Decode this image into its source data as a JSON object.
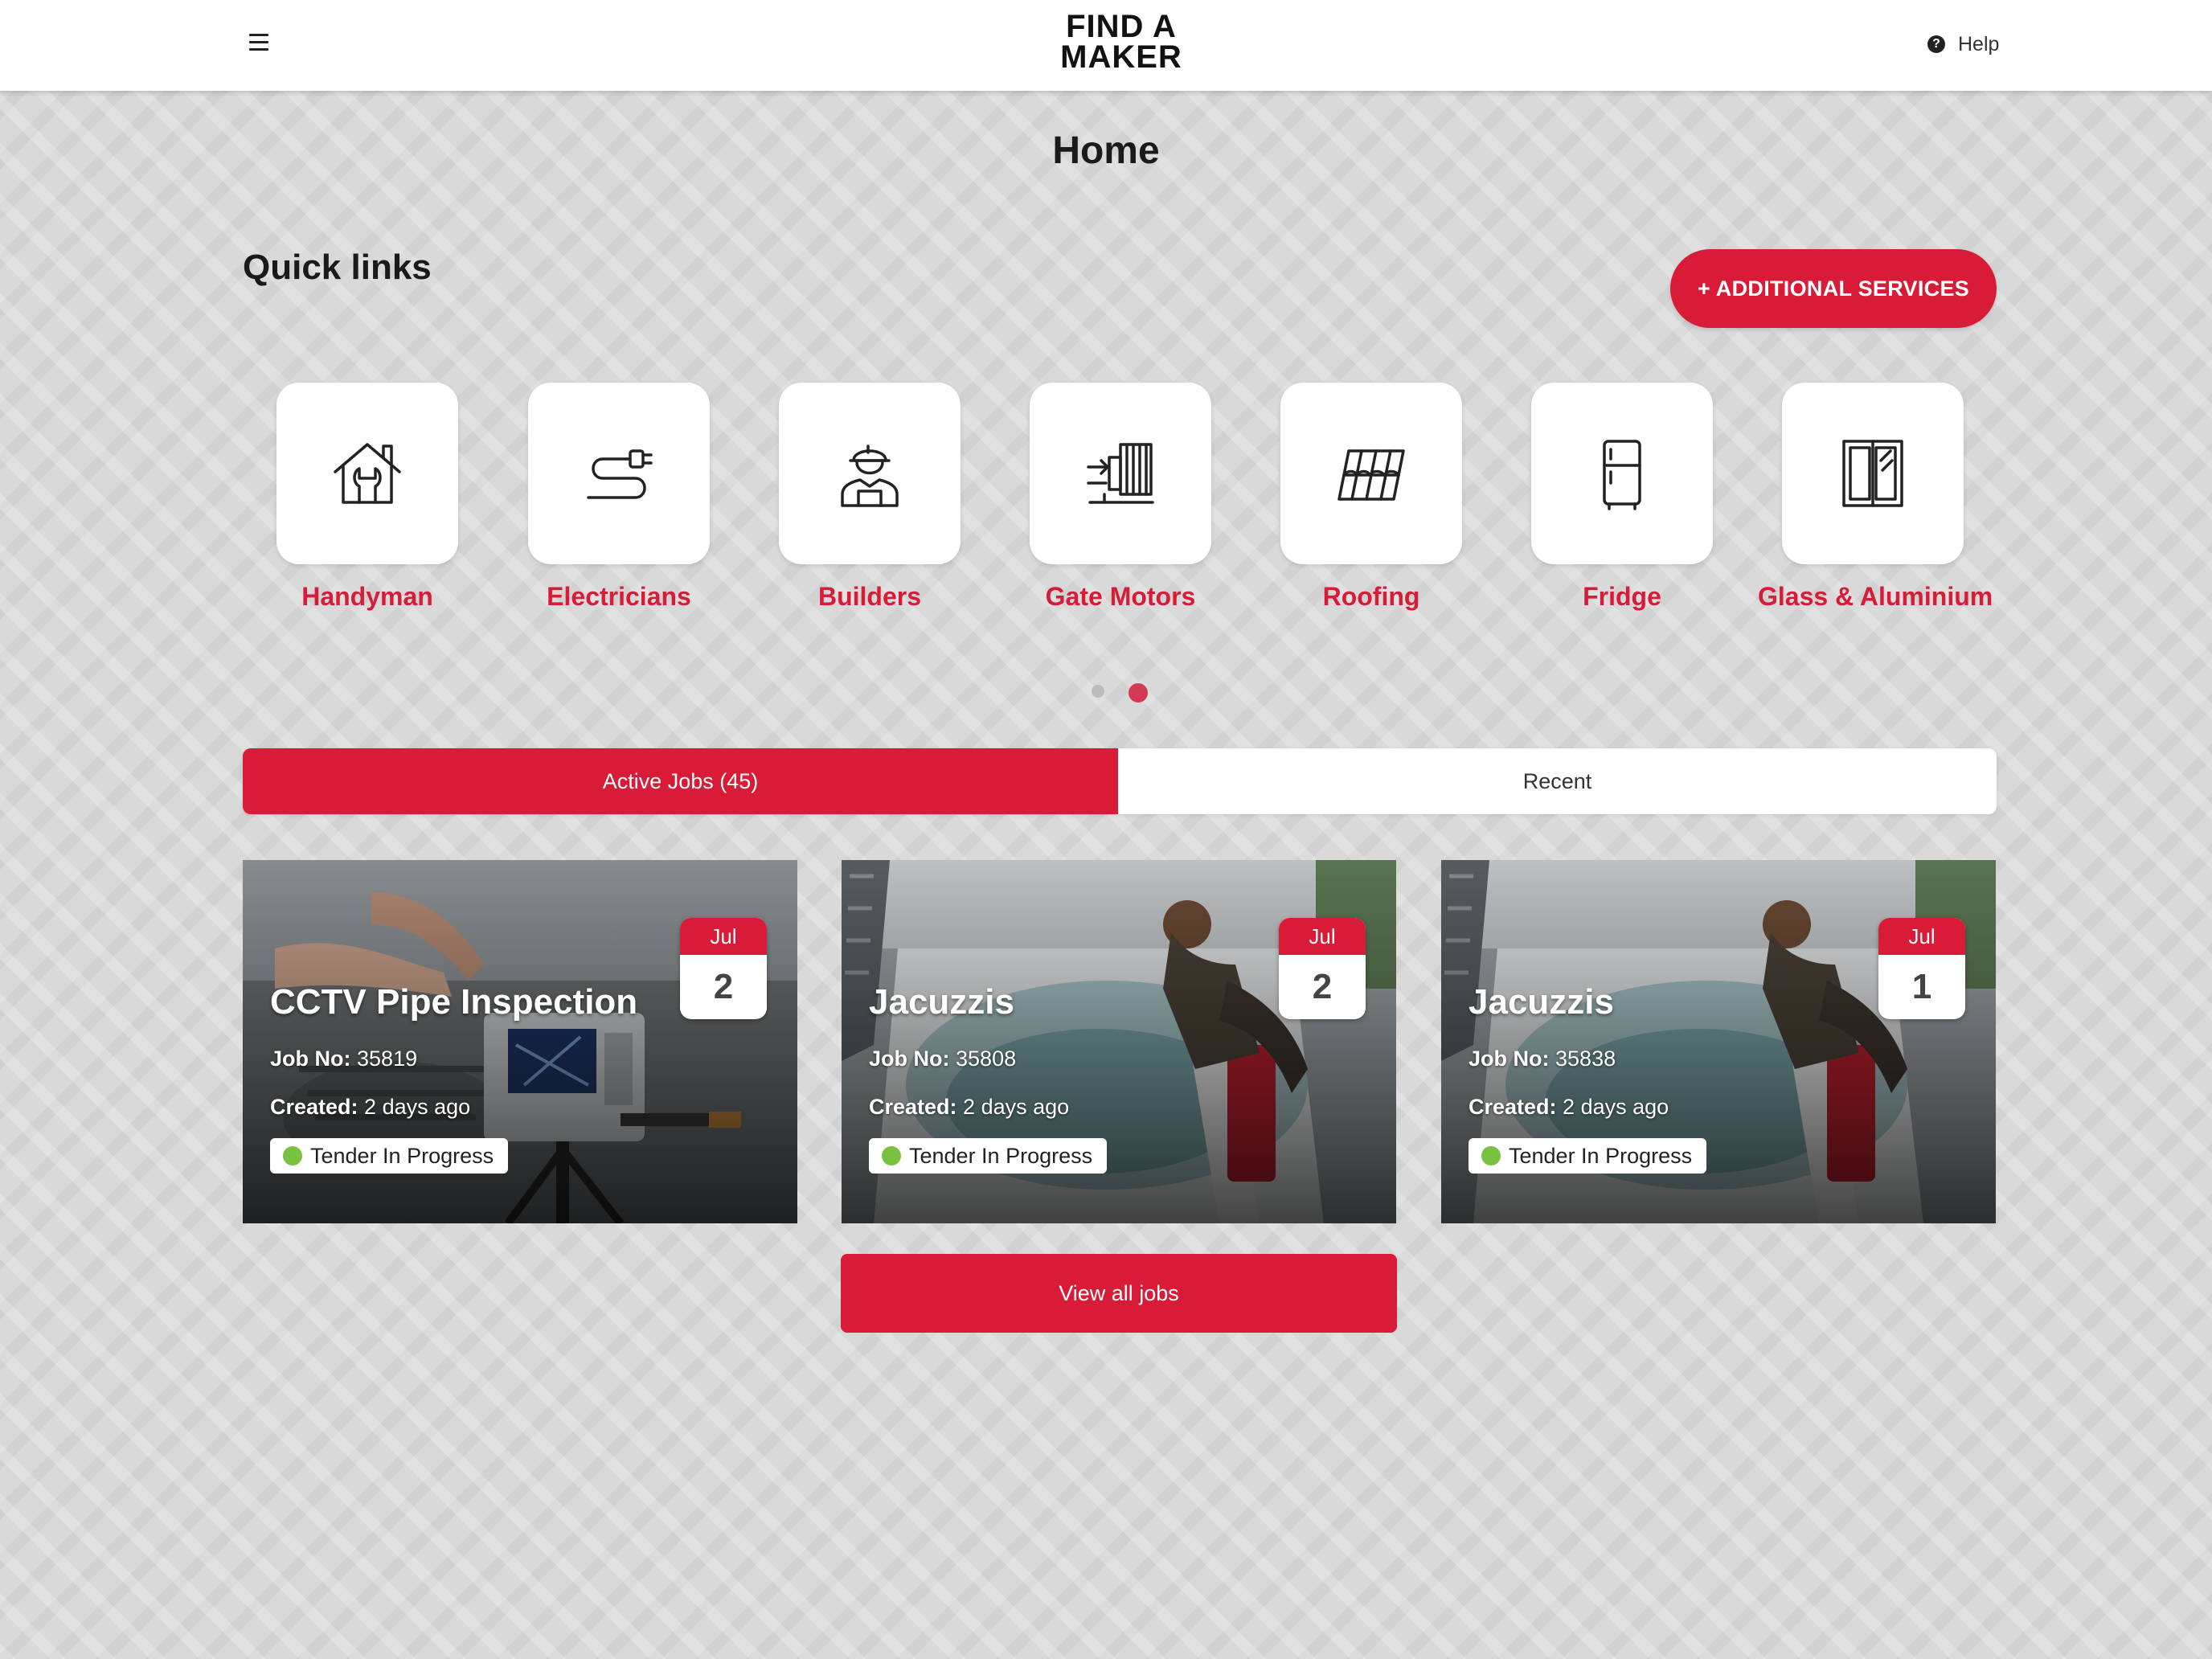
{
  "header": {
    "logo_line1": "FIND A",
    "logo_line2": "MAKER",
    "help_label": "Help",
    "help_icon_glyph": "?"
  },
  "page": {
    "title": "Home"
  },
  "quick_links": {
    "title": "Quick links",
    "additional_services_label": "+ ADDITIONAL SERVICES",
    "items": [
      {
        "label": "Handyman",
        "icon": "house-wrench-icon"
      },
      {
        "label": "Electricians",
        "icon": "plug-cable-icon"
      },
      {
        "label": "Builders",
        "icon": "builder-worker-icon"
      },
      {
        "label": "Gate Motors",
        "icon": "gate-motor-icon"
      },
      {
        "label": "Roofing",
        "icon": "roof-tiles-icon"
      },
      {
        "label": "Fridge",
        "icon": "fridge-icon"
      },
      {
        "label": "Glass & Aluminium",
        "icon": "window-icon"
      }
    ],
    "carousel": {
      "pages": 2,
      "active_page": 2
    }
  },
  "tabs": [
    {
      "label": "Active Jobs (45)",
      "active": true
    },
    {
      "label": "Recent",
      "active": false
    }
  ],
  "jobs": [
    {
      "title": "CCTV Pipe Inspection",
      "job_no_label": "Job No:",
      "job_no": "35819",
      "created_label": "Created:",
      "created": "2 days ago",
      "status": "Tender In Progress",
      "month": "Jul",
      "day": "2"
    },
    {
      "title": "Jacuzzis",
      "job_no_label": "Job No:",
      "job_no": "35808",
      "created_label": "Created:",
      "created": "2 days ago",
      "status": "Tender In Progress",
      "month": "Jul",
      "day": "2"
    },
    {
      "title": "Jacuzzis",
      "job_no_label": "Job No:",
      "job_no": "35838",
      "created_label": "Created:",
      "created": "2 days ago",
      "status": "Tender In Progress",
      "month": "Jul",
      "day": "1"
    }
  ],
  "view_all_label": "View all jobs",
  "colors": {
    "brand_red": "#d81b36",
    "status_green": "#7ac142",
    "background": "#d9d9d9"
  }
}
